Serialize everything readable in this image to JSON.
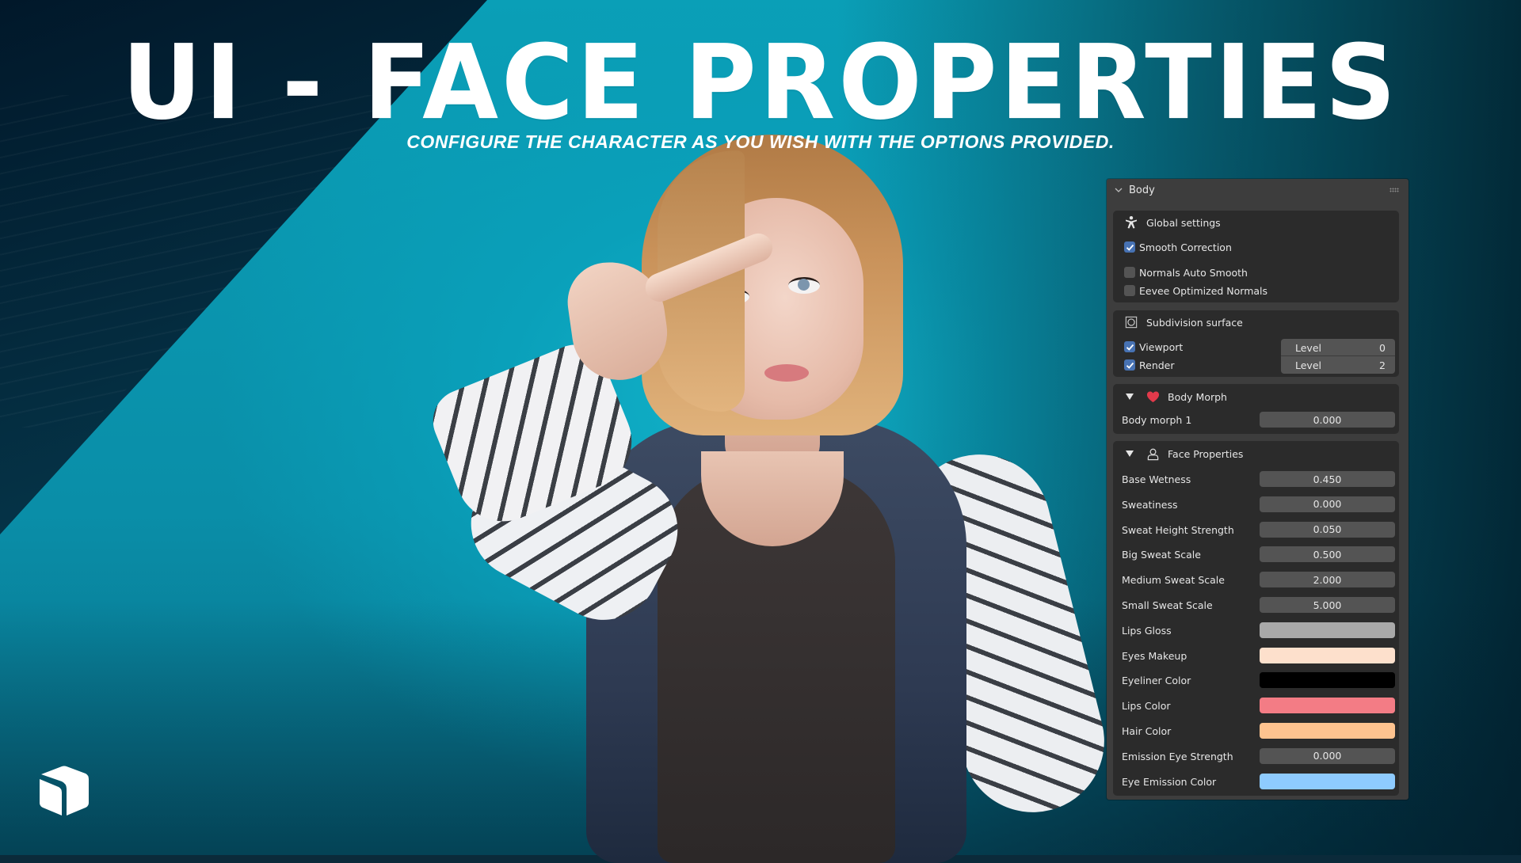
{
  "banner": {
    "title": "UI - FACE PROPERTIES",
    "subtitle": "CONFIGURE THE CHARACTER AS YOU WISH WITH THE OPTIONS PROVIDED.",
    "logo_icon": "cube-icon"
  },
  "panel": {
    "header": {
      "label": "Body",
      "icon": "chevron-down-icon",
      "handle_icon": "drag-handle-icon"
    },
    "global_settings": {
      "title": "Global settings",
      "icon": "armature-pose-icon",
      "options": [
        {
          "label": "Smooth Correction",
          "checked": true
        },
        {
          "label": "Normals Auto Smooth",
          "checked": false
        },
        {
          "label": "Eevee Optimized Normals",
          "checked": false
        }
      ]
    },
    "subdivision": {
      "title": "Subdivision surface",
      "icon": "subdivision-modifier-icon",
      "rows": [
        {
          "label": "Viewport",
          "checked": true,
          "field_label": "Level",
          "value": "0"
        },
        {
          "label": "Render",
          "checked": true,
          "field_label": "Level",
          "value": "2"
        }
      ]
    },
    "body_morph": {
      "title": "Body Morph",
      "icon": "heart-icon",
      "expanded": true,
      "props": [
        {
          "label": "Body morph 1",
          "value": "0.000"
        }
      ]
    },
    "face_properties": {
      "title": "Face Properties",
      "icon": "user-icon",
      "expanded": true,
      "props": [
        {
          "label": "Base Wetness",
          "type": "number",
          "value": "0.450"
        },
        {
          "label": "Sweatiness",
          "type": "number",
          "value": "0.000"
        },
        {
          "label": "Sweat Height Strength",
          "type": "number",
          "value": "0.050"
        },
        {
          "label": "Big Sweat Scale",
          "type": "number",
          "value": "0.500"
        },
        {
          "label": "Medium Sweat Scale",
          "type": "number",
          "value": "2.000"
        },
        {
          "label": "Small Sweat Scale",
          "type": "number",
          "value": "5.000"
        },
        {
          "label": "Lips Gloss",
          "type": "color",
          "color": "#a9a9a9"
        },
        {
          "label": "Eyes Makeup",
          "type": "color",
          "color": "#fde0cc"
        },
        {
          "label": "Eyeliner Color",
          "type": "color",
          "color": "#000000"
        },
        {
          "label": "Lips Color",
          "type": "color",
          "color": "#f37c85"
        },
        {
          "label": "Hair Color",
          "type": "color",
          "color": "#fec38f"
        },
        {
          "label": "Emission Eye Strength",
          "type": "number",
          "value": "0.000"
        },
        {
          "label": "Eye Emission Color",
          "type": "color",
          "color": "#8ecbff"
        }
      ]
    }
  },
  "colors": {
    "accent_checkbox": "#4772b3",
    "panel_bg": "#3d3d3d",
    "box_bg": "#2b2b2b",
    "field_bg": "#545454",
    "heart": "#e23a4b"
  }
}
